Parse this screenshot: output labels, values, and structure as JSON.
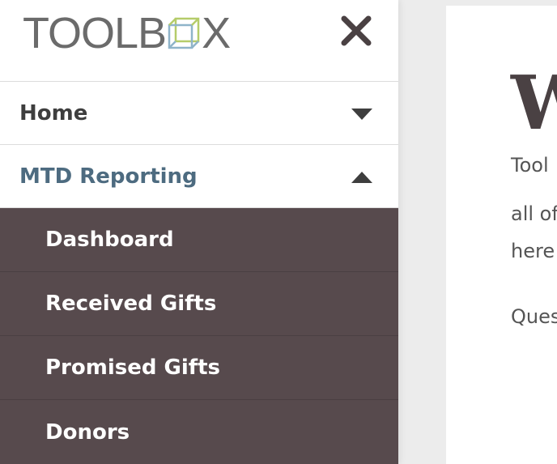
{
  "brand": {
    "logo_text_left": "TOOLB",
    "logo_text_right": "X",
    "logo_icon": "cube-icon",
    "close_icon": "close-icon"
  },
  "nav": [
    {
      "label": "Home",
      "expanded": false,
      "icon": "caret-down-icon"
    },
    {
      "label": "MTD Reporting",
      "expanded": true,
      "icon": "caret-up-icon",
      "children": [
        "Dashboard",
        "Received Gifts",
        "Promised Gifts",
        "Donors"
      ]
    }
  ],
  "main": {
    "title": "W",
    "lines": [
      "Tool",
      "all of",
      "here"
    ],
    "question": "Ques"
  },
  "colors": {
    "active": "#4d6b80",
    "submenu_bg": "#574a4d",
    "page_bg": "#ececec"
  }
}
